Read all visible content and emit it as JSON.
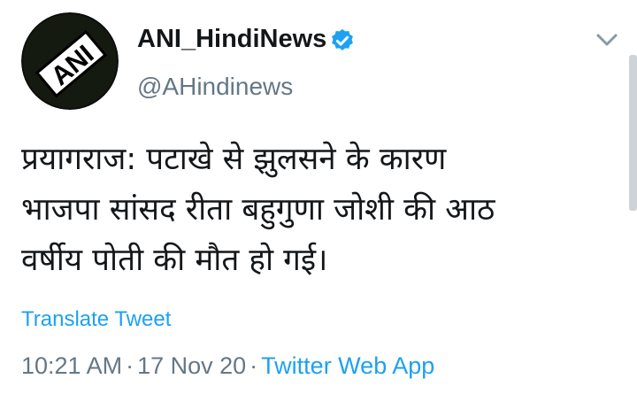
{
  "user": {
    "avatar_icon": "ani-logo-avatar",
    "avatar_text": "ANI",
    "display_name": "ANI_HindiNews",
    "verified_icon": "verified-badge-icon",
    "handle": "@AHindinews"
  },
  "menu": {
    "icon": "chevron-down-icon"
  },
  "tweet": {
    "lines": [
      "प्रयागराज: पटाखे से झुलसने के कारण",
      "भाजपा सांसद रीता बहुगुणा जोशी की आठ",
      "वर्षीय पोती की मौत हो गई।"
    ],
    "translate_label": "Translate Tweet",
    "time": "10:21 AM",
    "separator": "·",
    "date": "17 Nov 20",
    "source": "Twitter Web App"
  },
  "colors": {
    "link": "#1da1f2",
    "muted": "#657786",
    "text": "#14171a"
  }
}
